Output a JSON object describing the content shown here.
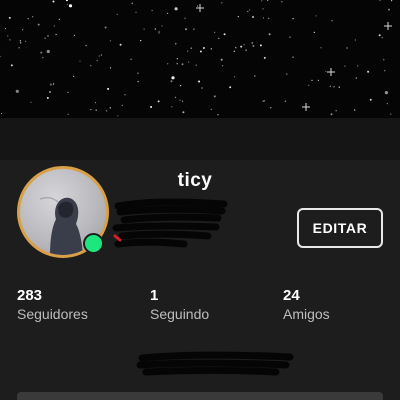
{
  "profile": {
    "username": "ticy",
    "edit_label": "EDITAR",
    "status": "online",
    "colors": {
      "avatar_ring": "#d9a047",
      "online_dot": "#1ee67e",
      "background": "#1d1d1d"
    }
  },
  "stats": [
    {
      "value": "283",
      "label": "Seguidores"
    },
    {
      "value": "1",
      "label": "Seguindo"
    },
    {
      "value": "24",
      "label": "Amigos"
    }
  ]
}
